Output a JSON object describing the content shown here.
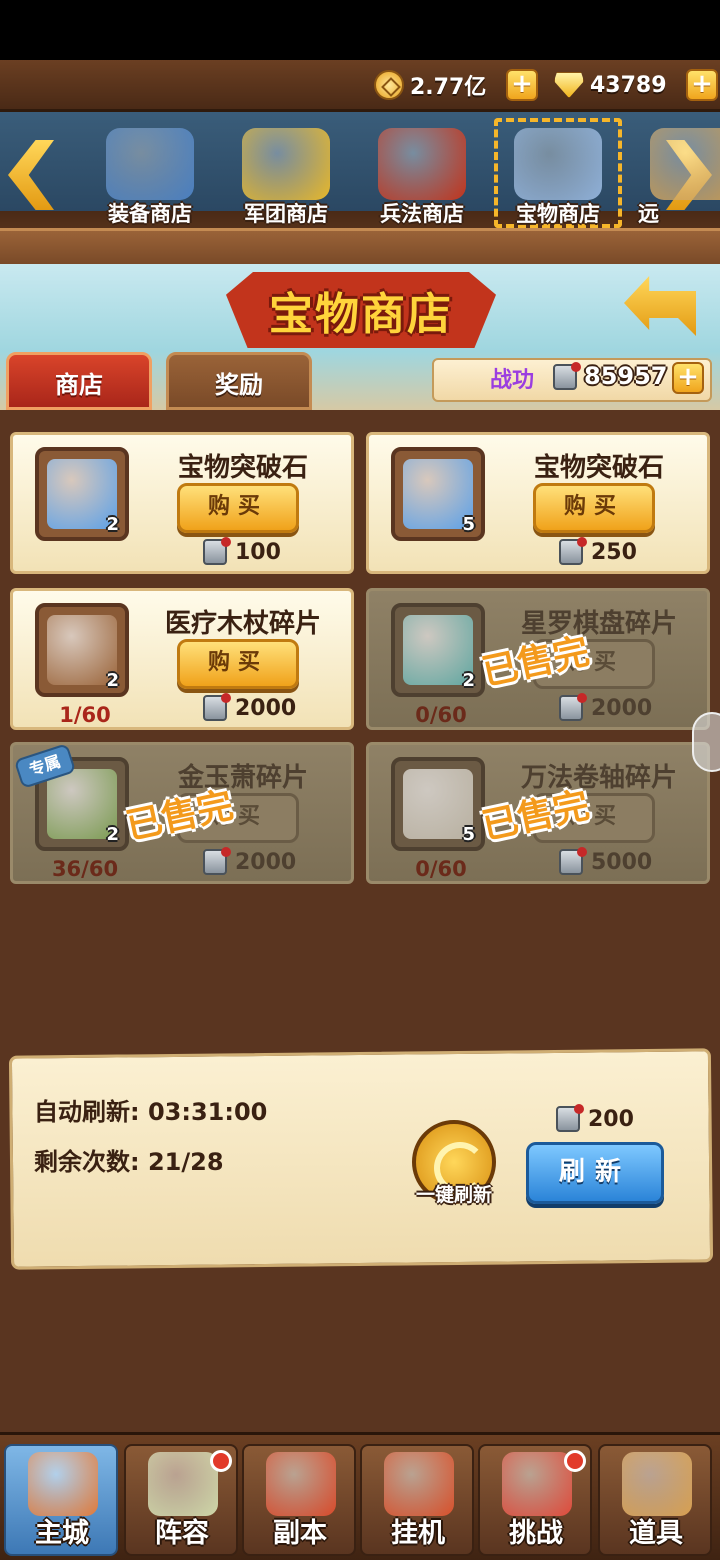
{
  "currency": {
    "gold": "2.77亿",
    "gems": "43789"
  },
  "shops": [
    {
      "label": "装备商店",
      "icon": "armor-icon",
      "color": "#4a7fc0"
    },
    {
      "label": "军团商店",
      "icon": "gold-ingot-icon",
      "color": "#e8b82a"
    },
    {
      "label": "兵法商店",
      "icon": "tactics-book-icon",
      "color": "#c2341c"
    },
    {
      "label": "宝物商店",
      "icon": "treasure-icon",
      "color": "#8fb0d8"
    },
    {
      "label": "远",
      "icon": "partial-shop-icon",
      "color": "#c79a52"
    }
  ],
  "page": {
    "title": "宝物商店",
    "tab_shop": "商店",
    "tab_reward": "奖励",
    "merit_label": "战功",
    "merit_value": "85957"
  },
  "items": [
    {
      "name": "宝物突破石",
      "count": "2",
      "price": "100",
      "progress": "",
      "soldout": false,
      "buy": "购买",
      "icon": "blue-stone-icon",
      "art": "#5aa0e8"
    },
    {
      "name": "宝物突破石",
      "count": "5",
      "price": "250",
      "progress": "",
      "soldout": false,
      "buy": "购买",
      "icon": "blue-stone-icon",
      "art": "#5aa0e8"
    },
    {
      "name": "医疗木杖碎片",
      "count": "2",
      "price": "2000",
      "progress": "1/60",
      "soldout": false,
      "buy": "购买",
      "icon": "wooden-staff-icon",
      "art": "#9a6338"
    },
    {
      "name": "星罗棋盘碎片",
      "count": "2",
      "price": "2000",
      "progress": "0/60",
      "soldout": true,
      "buy": "购买",
      "stamp": "已售完",
      "icon": "chessboard-icon",
      "art": "#5fa6a0"
    },
    {
      "name": "金玉萧碎片",
      "count": "2",
      "price": "2000",
      "progress": "36/60",
      "soldout": true,
      "buy": "购买",
      "stamp": "已售完",
      "tag": "专属",
      "icon": "jade-flute-icon",
      "art": "#7a9a50"
    },
    {
      "name": "万法卷轴碎片",
      "count": "5",
      "price": "5000",
      "progress": "0/60",
      "soldout": true,
      "buy": "购买",
      "stamp": "已售完",
      "icon": "scroll-icon",
      "art": "#b8b0a0"
    }
  ],
  "refresh": {
    "auto_label": "自动刷新:",
    "auto_time": "03:31:00",
    "remain_label": "剩余次数:",
    "remain_value": "21/28",
    "one_key_label": "一键刷新",
    "cost": "200",
    "button": "刷新"
  },
  "nav": [
    {
      "label": "主城",
      "icon": "palace-icon",
      "color": "#e07a3a",
      "dot": false,
      "active": true
    },
    {
      "label": "阵容",
      "icon": "formation-icon",
      "color": "#cfd8a8",
      "dot": true,
      "active": false
    },
    {
      "label": "副本",
      "icon": "lantern-icon",
      "color": "#d94a2a",
      "dot": false,
      "active": false
    },
    {
      "label": "挂机",
      "icon": "treasure-bag-icon",
      "color": "#d9502a",
      "dot": false,
      "active": false
    },
    {
      "label": "挑战",
      "icon": "versus-icon",
      "color": "#e04a3a",
      "dot": true,
      "active": false
    },
    {
      "label": "道具",
      "icon": "item-bag-icon",
      "color": "#d8a050",
      "dot": false,
      "active": false
    }
  ]
}
